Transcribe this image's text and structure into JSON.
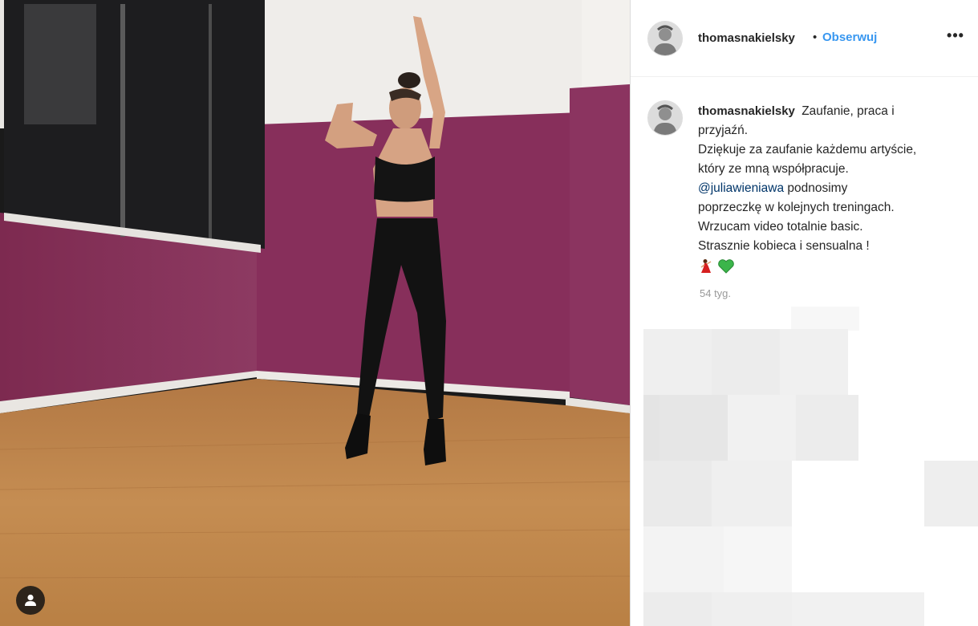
{
  "post": {
    "author": "thomasnakielsky",
    "separator": "•",
    "follow_label": "Obserwuj",
    "more_label": "•••",
    "caption_lines": [
      "Zaufanie, praca i",
      "przyjaźń.",
      "Dziękuje za zaufanie każdemu artyście,",
      "który ze mną współpracuje."
    ],
    "mention": "@juliawieniawa",
    "caption_after_mention": [
      " podnosimy",
      "poprzeczkę w kolejnych treningach.",
      "Wrzucam video totalnie basic.",
      "Strasznie kobieca i sensualna !"
    ],
    "emojis": [
      "dancer-emoji",
      "green-heart-emoji"
    ],
    "timestamp": "54 tyg."
  },
  "icons": {
    "tag_user": "user-tag-icon",
    "more": "more-options-icon"
  },
  "colors": {
    "link_blue": "#3897f0",
    "mention": "#003569",
    "wall": "#8a2f58",
    "floor": "#c48a4e"
  }
}
